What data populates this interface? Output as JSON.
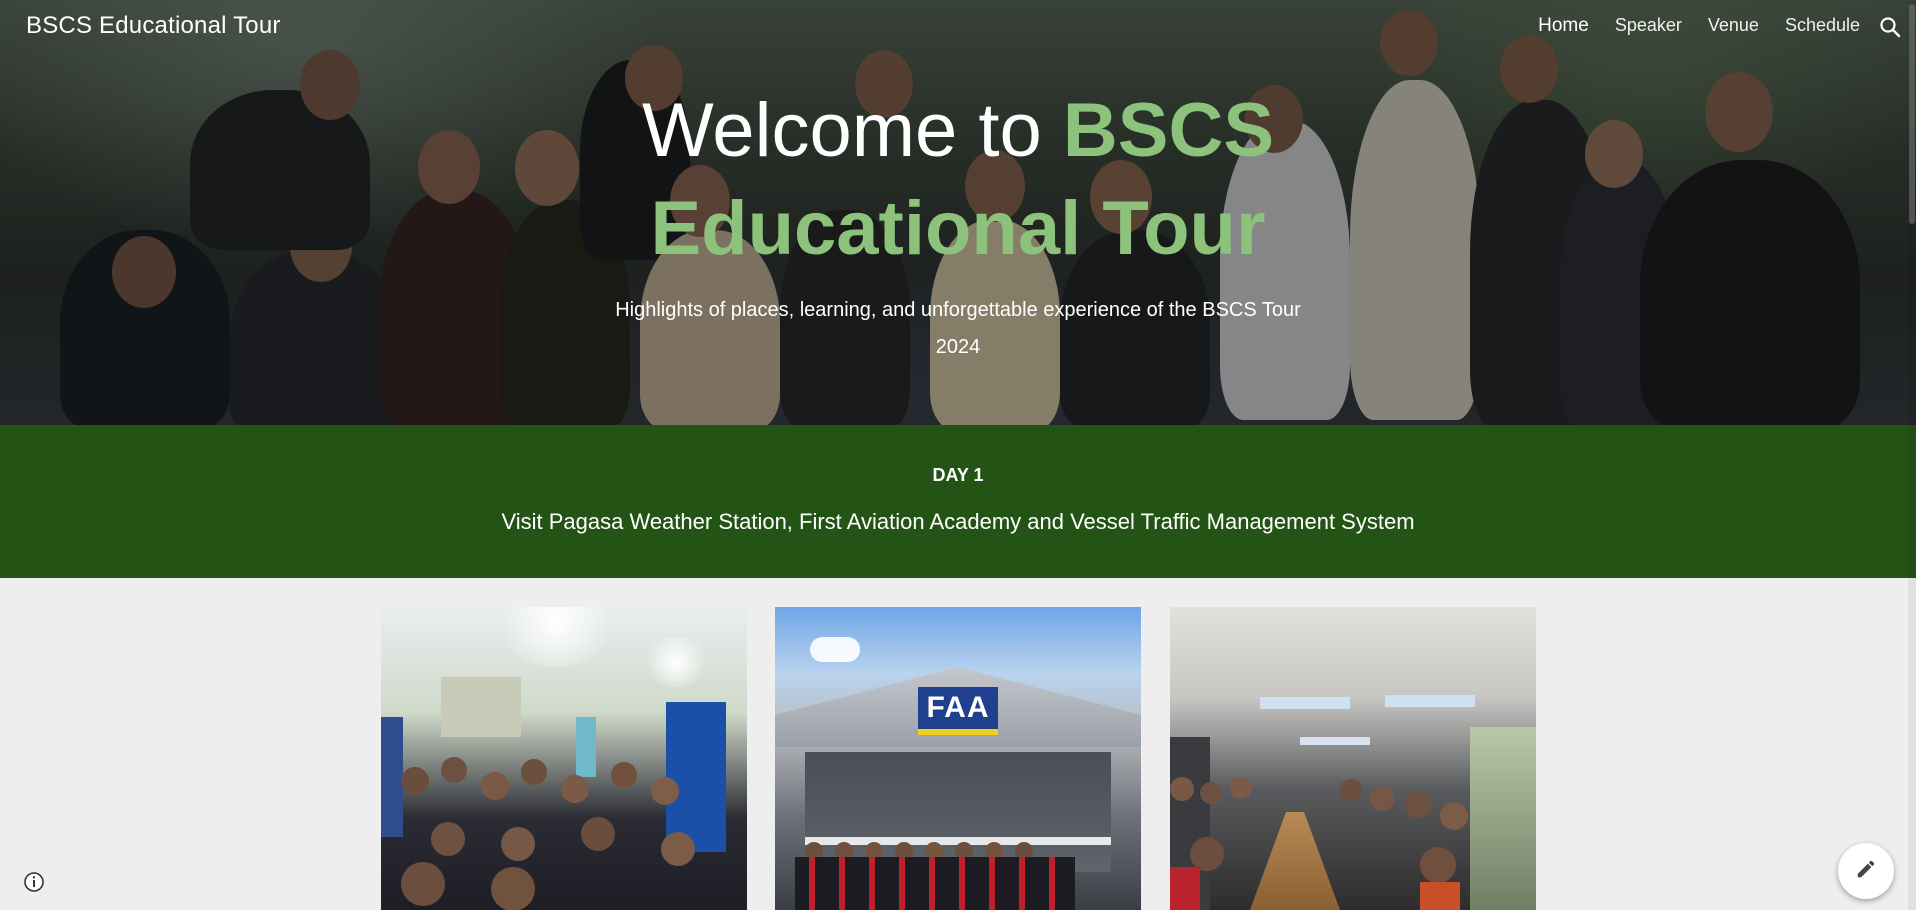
{
  "site": {
    "title": "BSCS Educational Tour"
  },
  "nav": {
    "items": [
      {
        "label": "Home",
        "active": true
      },
      {
        "label": "Speaker",
        "active": false
      },
      {
        "label": "Venue",
        "active": false
      },
      {
        "label": "Schedule",
        "active": false
      }
    ],
    "search_icon": "search-icon"
  },
  "hero": {
    "title_prefix": "Welcome to ",
    "title_accent": "BSCS Educational Tour",
    "subtitle": "Highlights of places, learning, and unforgettable experience of the BSCS Tour 2024",
    "accent_color": "#8cc27b"
  },
  "day": {
    "label": "DAY 1",
    "description": "Visit Pagasa Weather Station, First Aviation Academy and Vessel Traffic Management System",
    "band_color": "#245316"
  },
  "photos": {
    "hangar_sign": "FAA"
  },
  "floating": {
    "info_icon": "info-icon",
    "edit_icon": "pencil-icon"
  }
}
